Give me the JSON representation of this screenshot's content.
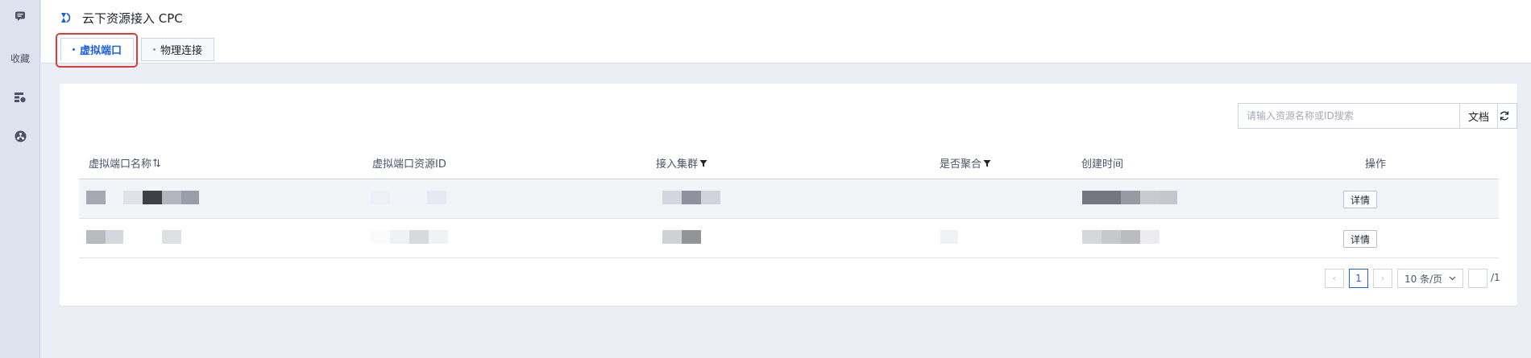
{
  "sidebar": {
    "items": [
      {
        "icon": "message-icon"
      },
      {
        "label": "收藏"
      },
      {
        "icon": "cloud-server-icon"
      },
      {
        "icon": "network-icon"
      }
    ]
  },
  "header": {
    "title": "云下资源接入 CPC",
    "tabs": [
      {
        "label": "虚拟端口",
        "active": true
      },
      {
        "label": "物理连接",
        "active": false
      }
    ]
  },
  "toolbar": {
    "search_placeholder": "请输入资源名称或ID搜索",
    "refresh_icon": "refresh-icon",
    "docs_label": "文档"
  },
  "table": {
    "columns": [
      "虚拟端口名称",
      "虚拟端口资源ID",
      "接入集群",
      "是否聚合",
      "创建时间",
      "操作"
    ],
    "rows": [
      {
        "action_label": "详情"
      },
      {
        "action_label": "详情"
      }
    ]
  },
  "pagination": {
    "prev": "‹",
    "current_page": "1",
    "next": "›",
    "page_size": "10 条/页",
    "total_pages": "/1"
  },
  "colors": {
    "accent": "#1f5fe0",
    "highlight": "#e03b3b",
    "background": "#eceef6"
  }
}
